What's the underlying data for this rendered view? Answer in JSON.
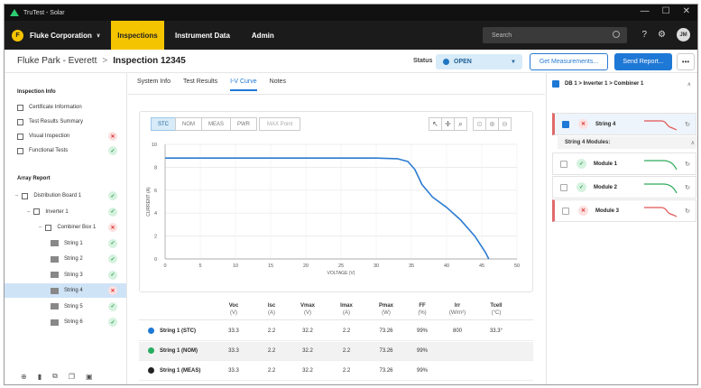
{
  "window": {
    "title": "TruTest - Solar",
    "controls": [
      "—",
      "☐",
      "✕"
    ]
  },
  "nav": {
    "brand_initial": "F",
    "brand": "Fluke Corporation",
    "tabs": [
      "Inspections",
      "Instrument Data",
      "Admin"
    ],
    "search_placeholder": "Search",
    "avatar": "JM"
  },
  "header": {
    "breadcrumb_parent": "Fluke Park - Everett",
    "breadcrumb_sep": ">",
    "breadcrumb_current": "Inspection 12345",
    "status_label": "Status",
    "status_value": "OPEN",
    "get_measurements": "Get Measurements...",
    "send_report": "Send Report...",
    "more": "•••"
  },
  "sidebar": {
    "inspection_info_title": "Inspection Info",
    "info_items": [
      {
        "label": "Certificate Information",
        "status": ""
      },
      {
        "label": "Test Results Summary",
        "status": ""
      },
      {
        "label": "Visual Inspection",
        "status": "bad"
      },
      {
        "label": "Functional Tests",
        "status": "ok"
      }
    ],
    "array_title": "Array Report",
    "tree": [
      {
        "label": "Distribution Board 1",
        "indent": 0,
        "status": "ok",
        "twisty": "–"
      },
      {
        "label": "Inverter 1",
        "indent": 1,
        "status": "ok",
        "twisty": "–"
      },
      {
        "label": "Combiner Box 1",
        "indent": 2,
        "status": "bad",
        "twisty": "–"
      },
      {
        "label": "String 1",
        "indent": 3,
        "status": "ok",
        "twisty": ""
      },
      {
        "label": "String 2",
        "indent": 3,
        "status": "ok",
        "twisty": ""
      },
      {
        "label": "String 3",
        "indent": 3,
        "status": "ok",
        "twisty": ""
      },
      {
        "label": "String 4",
        "indent": 3,
        "status": "bad",
        "twisty": ""
      },
      {
        "label": "String 5",
        "indent": 3,
        "status": "ok",
        "twisty": ""
      },
      {
        "label": "String 6",
        "indent": 3,
        "status": "ok",
        "twisty": ""
      }
    ]
  },
  "main": {
    "tabs": [
      "System Info",
      "Test Results",
      "I-V Curve",
      "Notes"
    ],
    "modes": [
      "STC",
      "NOM",
      "MEAS",
      "PWR"
    ],
    "max_point": "MAX Point"
  },
  "chart_data": {
    "type": "line",
    "xlabel": "VOLTAGE (V)",
    "ylabel": "CURRENT (A)",
    "xlim": [
      0,
      50
    ],
    "ylim": [
      0,
      10
    ],
    "xticks": [
      0,
      5,
      10,
      15,
      20,
      25,
      30,
      35,
      40,
      45,
      50
    ],
    "yticks": [
      0,
      2,
      4,
      6,
      8,
      10
    ],
    "series": [
      {
        "color": "#2b7bd0",
        "points": [
          [
            0,
            8.8
          ],
          [
            30,
            8.8
          ],
          [
            33,
            8.75
          ],
          [
            34.5,
            8.5
          ],
          [
            35.5,
            7.8
          ],
          [
            36.5,
            6.5
          ],
          [
            38,
            5.4
          ],
          [
            40,
            4.5
          ],
          [
            42,
            3.4
          ],
          [
            44,
            2.0
          ],
          [
            45.5,
            0.6
          ],
          [
            46,
            0
          ]
        ]
      }
    ]
  },
  "table": {
    "headers": [
      {
        "name": "Voc",
        "unit": "(V)"
      },
      {
        "name": "Isc",
        "unit": "(A)"
      },
      {
        "name": "Vmax",
        "unit": "(V)"
      },
      {
        "name": "Imax",
        "unit": "(A)"
      },
      {
        "name": "Pmax",
        "unit": "(W)"
      },
      {
        "name": "FF",
        "unit": "(%)"
      },
      {
        "name": "Irr",
        "unit": "(W/m²)"
      },
      {
        "name": "Tcell",
        "unit": "(°C)"
      }
    ],
    "rows": [
      {
        "name": "String 1 (STC)",
        "color": "#1e78d6",
        "values": [
          "33.3",
          "2.2",
          "32.2",
          "2.2",
          "73.26",
          "99%",
          "800",
          "33.3°"
        ]
      },
      {
        "name": "String 1 (NOM)",
        "color": "#27ae60",
        "values": [
          "33.3",
          "2.2",
          "32.2",
          "2.2",
          "73.26",
          "99%",
          "",
          ""
        ]
      },
      {
        "name": "String 1 (MEAS)",
        "color": "#222222",
        "values": [
          "33.3",
          "2.2",
          "32.2",
          "2.2",
          "73.26",
          "99%",
          "",
          ""
        ]
      }
    ]
  },
  "right_panel": {
    "path": "DB 1 > Inverter 1 > Combiner 1",
    "string_card": {
      "label": "String 4",
      "status": "bad"
    },
    "modules_title": "String 4 Modules:",
    "modules": [
      {
        "label": "Module 1",
        "status": "ok"
      },
      {
        "label": "Module 2",
        "status": "ok"
      },
      {
        "label": "Module 3",
        "status": "bad"
      }
    ]
  }
}
